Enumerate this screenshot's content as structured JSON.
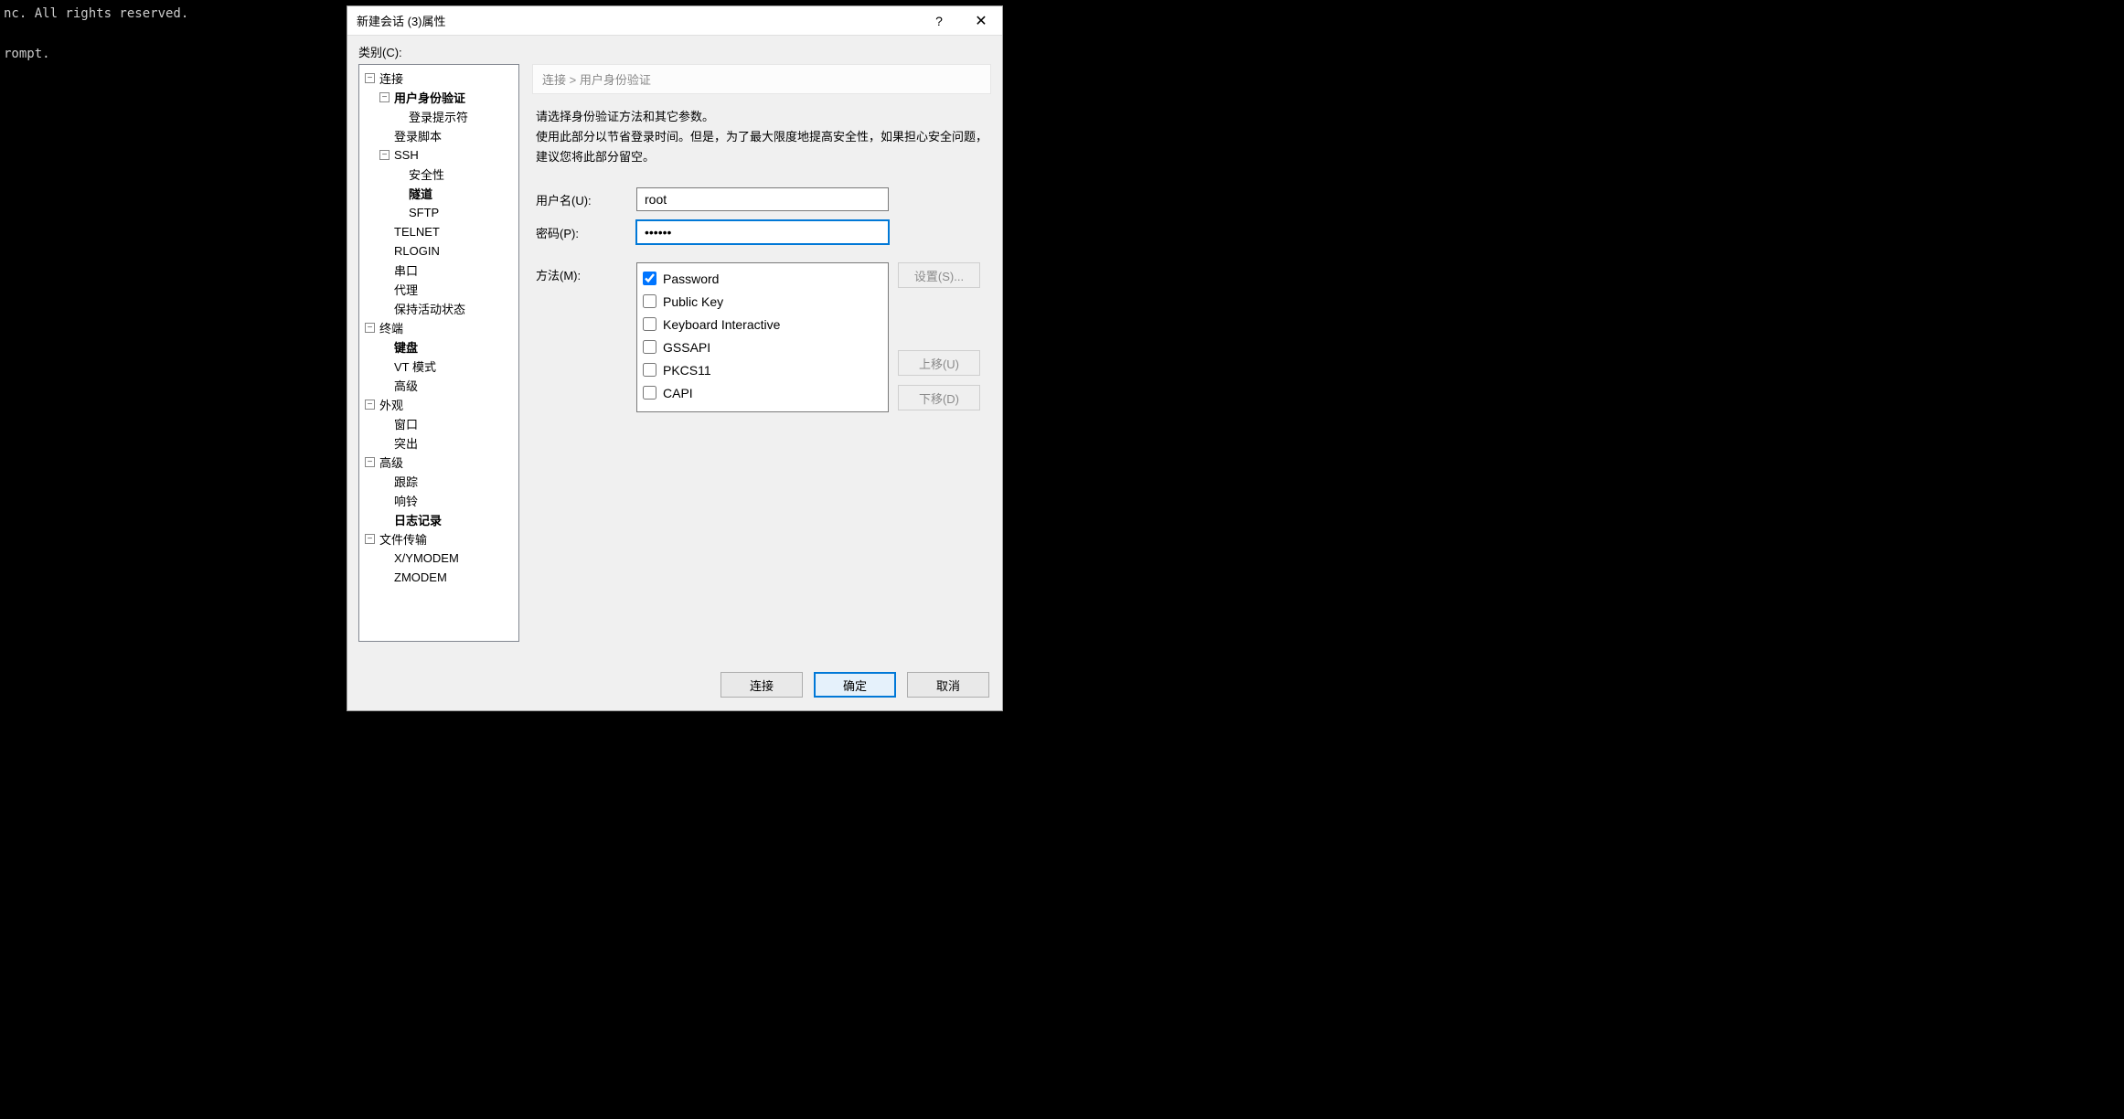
{
  "background": {
    "line1": "nc. All rights reserved.",
    "line2": "rompt."
  },
  "dialog": {
    "title": "新建会话 (3)属性",
    "help": "?",
    "close": "✕",
    "category_label": "类别(C):"
  },
  "tree": {
    "connection": "连接",
    "authentication": "用户身份验证",
    "login_prompt": "登录提示符",
    "login_script": "登录脚本",
    "ssh": "SSH",
    "security": "安全性",
    "tunnel": "隧道",
    "sftp": "SFTP",
    "telnet": "TELNET",
    "rlogin": "RLOGIN",
    "serial": "串口",
    "proxy": "代理",
    "keepalive": "保持活动状态",
    "terminal": "终端",
    "keyboard": "键盘",
    "vtmode": "VT 模式",
    "advanced_term": "高级",
    "appearance": "外观",
    "window": "窗口",
    "highlight": "突出",
    "advanced": "高级",
    "trace": "跟踪",
    "bell": "响铃",
    "logging": "日志记录",
    "filetrans": "文件传输",
    "xymodem": "X/YMODEM",
    "zmodem": "ZMODEM"
  },
  "breadcrumb": "连接  >  用户身份验证",
  "description": {
    "l1": "请选择身份验证方法和其它参数。",
    "l2": "使用此部分以节省登录时间。但是，为了最大限度地提高安全性，如果担心安全问题，建议您将此部分留空。"
  },
  "form": {
    "username_label": "用户名(U):",
    "username_value": "root",
    "password_label": "密码(P):",
    "password_value": "••••••",
    "method_label": "方法(M):"
  },
  "methods": [
    {
      "label": "Password",
      "checked": true
    },
    {
      "label": "Public Key",
      "checked": false
    },
    {
      "label": "Keyboard Interactive",
      "checked": false
    },
    {
      "label": "GSSAPI",
      "checked": false
    },
    {
      "label": "PKCS11",
      "checked": false
    },
    {
      "label": "CAPI",
      "checked": false
    }
  ],
  "buttons": {
    "setup": "设置(S)...",
    "move_up": "上移(U)",
    "move_down": "下移(D)",
    "connect": "连接",
    "ok": "确定",
    "cancel": "取消"
  }
}
